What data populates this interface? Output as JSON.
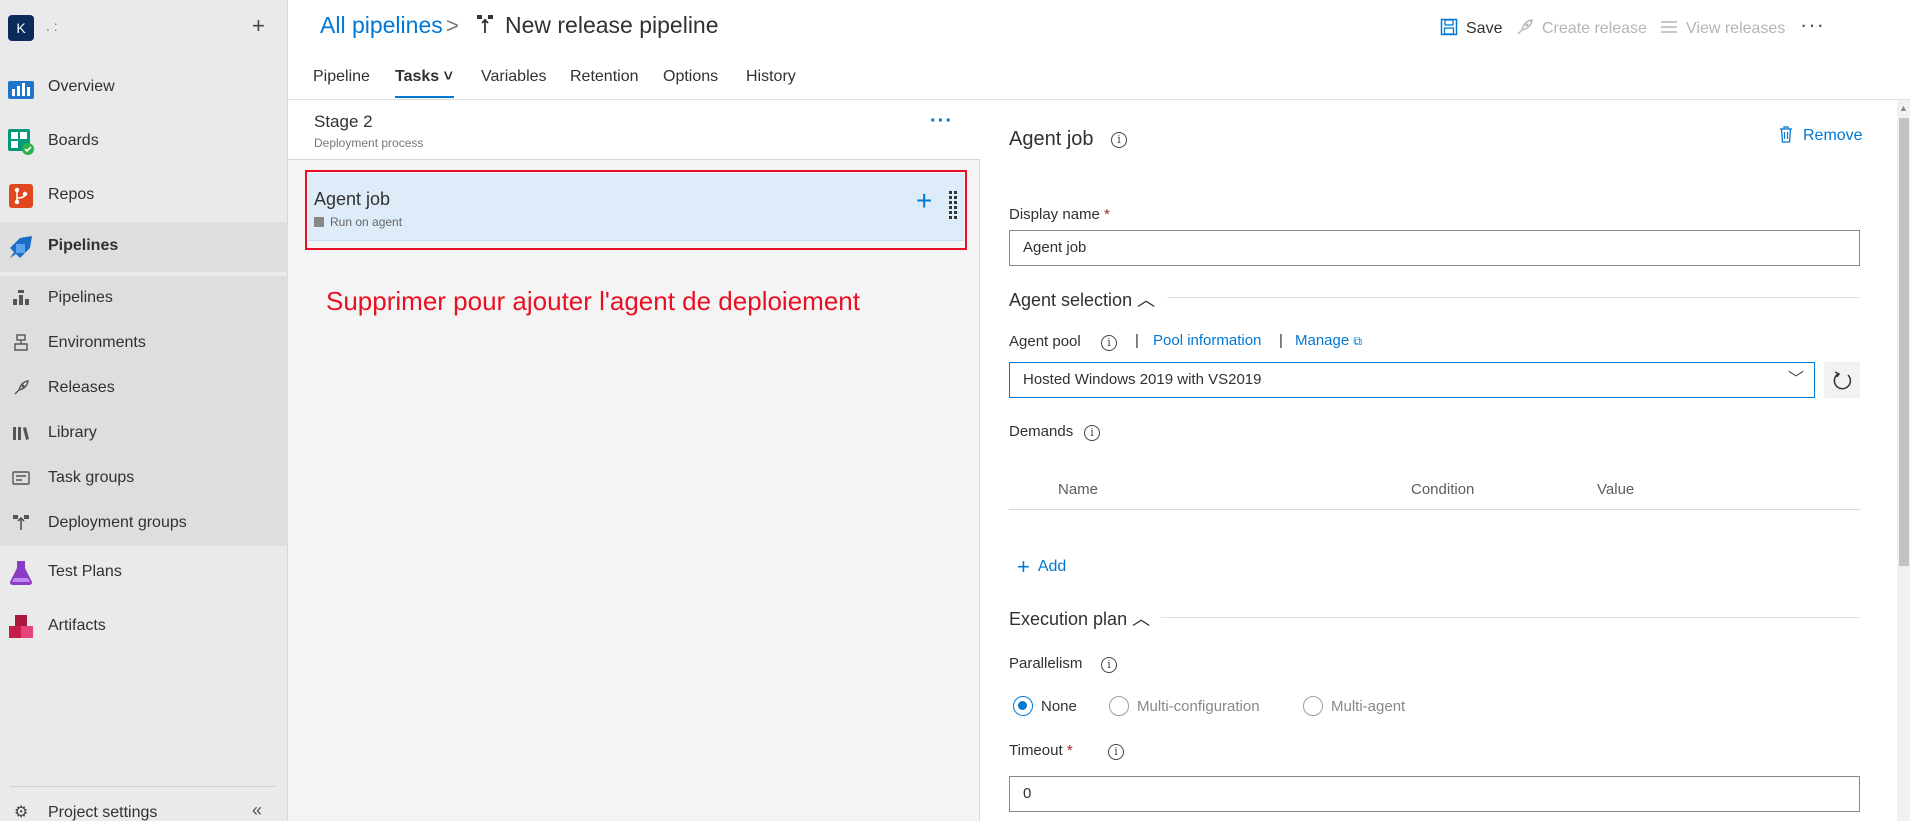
{
  "sidebar": {
    "org_initial": "K",
    "org_name": ". :",
    "add_label": "+",
    "items": [
      {
        "label": "Overview"
      },
      {
        "label": "Boards"
      },
      {
        "label": "Repos"
      },
      {
        "label": "Pipelines"
      },
      {
        "label": "Test Plans"
      },
      {
        "label": "Artifacts"
      }
    ],
    "sub_items": [
      {
        "label": "Pipelines"
      },
      {
        "label": "Environments"
      },
      {
        "label": "Releases"
      },
      {
        "label": "Library"
      },
      {
        "label": "Task groups"
      },
      {
        "label": "Deployment groups"
      }
    ],
    "settings_label": "Project settings",
    "collapse_label": "«"
  },
  "header": {
    "breadcrumb_root": "All pipelines",
    "breadcrumb_sep": ">",
    "title": "New release pipeline",
    "save_label": "Save",
    "create_release_label": "Create release",
    "view_releases_label": "View releases",
    "more_label": "···"
  },
  "tabs": [
    {
      "label": "Pipeline"
    },
    {
      "label": "Tasks ˅"
    },
    {
      "label": "Variables"
    },
    {
      "label": "Retention"
    },
    {
      "label": "Options"
    },
    {
      "label": "History"
    }
  ],
  "stage": {
    "name": "Stage 2",
    "subtitle": "Deployment process",
    "more_label": "···"
  },
  "job": {
    "name": "Agent job",
    "subtitle": "Run on agent",
    "add_label": "+"
  },
  "annotation": "Supprimer pour ajouter l'agent de deploiement",
  "details": {
    "title": "Agent job",
    "remove_label": "Remove",
    "display_name_label": "Display name",
    "display_name_value": "Agent job",
    "agent_selection_title": "Agent selection",
    "agent_pool_label": "Agent pool",
    "sep": "|",
    "pool_information_link": "Pool information",
    "manage_link": "Manage",
    "agent_pool_value": "Hosted Windows 2019 with VS2019",
    "demands_label": "Demands",
    "demands_columns": [
      "Name",
      "Condition",
      "Value"
    ],
    "add_label": "Add",
    "execution_plan_title": "Execution plan",
    "parallelism_label": "Parallelism",
    "parallelism_options": [
      {
        "label": "None",
        "checked": true
      },
      {
        "label": "Multi-configuration",
        "checked": false
      },
      {
        "label": "Multi-agent",
        "checked": false
      }
    ],
    "timeout_label": "Timeout",
    "timeout_value": "0",
    "required_mark": "*",
    "info_glyph": "i"
  },
  "colors": {
    "accent": "#0078d4",
    "annotation_red": "#e81123",
    "job_card_bg": "#deecf9",
    "sidebar_bg": "#eaeaea"
  }
}
